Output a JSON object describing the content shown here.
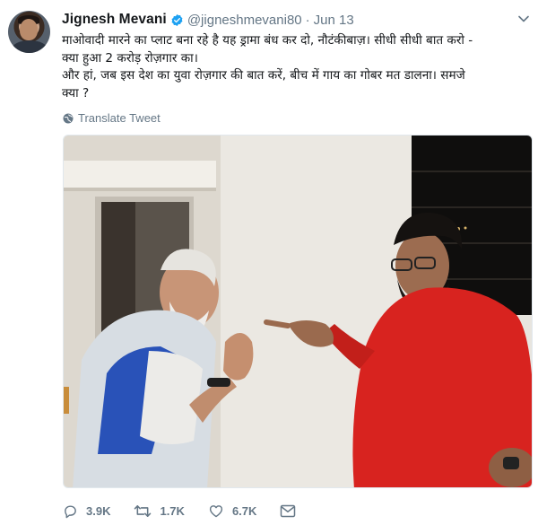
{
  "tweet": {
    "author": {
      "name": "Jignesh Mevani",
      "handle": "@jigneshmevani80",
      "verified": true,
      "avatar_icon": "user-avatar"
    },
    "separator": "·",
    "date": "Jun 13",
    "text_lines": [
      "माओवादी मारने का प्लाट बना रहे है यह ड्रामा बंध कर दो, नौटंकीबाज़। सीधी सीधी बात करो -",
      "क्या हुआ 2 करोड़ रोज़गार का।",
      "और हां, जब इस देश का युवा रोज़गार की बात करें, बीच में गाय का गोबर मत डालना। समजे",
      "क्या ?"
    ],
    "translate_label": "Translate Tweet",
    "actions": {
      "reply_count": "3.9K",
      "retweet_count": "1.7K",
      "like_count": "6.7K"
    },
    "icons": {
      "verified": "verified-badge-icon",
      "caret": "chevron-down-icon",
      "translate": "globe-icon",
      "reply": "reply-icon",
      "retweet": "retweet-icon",
      "like": "heart-icon",
      "message": "envelope-icon"
    },
    "colors": {
      "verified_blue": "#1da1f2",
      "secondary_text": "#657786",
      "primary_text": "#14171a"
    }
  }
}
